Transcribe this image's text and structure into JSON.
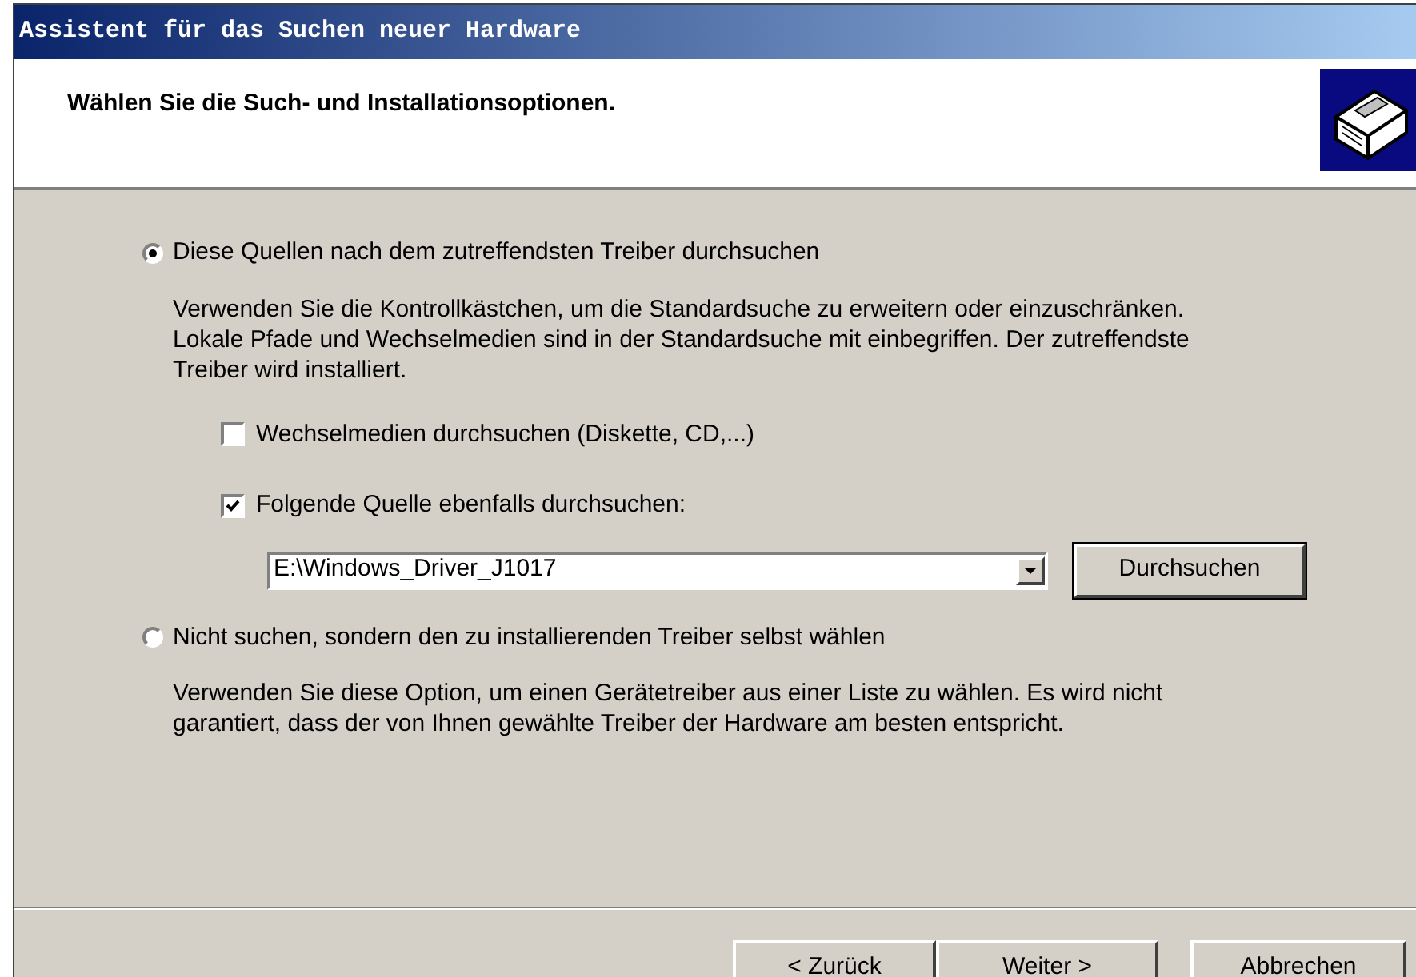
{
  "window": {
    "title": "Assistent für das Suchen neuer Hardware"
  },
  "header": {
    "heading": "Wählen Sie die Such- und Installationsoptionen."
  },
  "options": [
    {
      "label": "Diese Quellen nach dem zutreffendsten Treiber durchsuchen",
      "selected": true,
      "description": "Verwenden Sie die Kontrollkästchen, um die Standardsuche zu erweitern oder einzuschränken. Lokale Pfade und Wechselmedien sind in der Standardsuche mit einbegriffen. Der zutreffendste Treiber wird installiert.",
      "checkboxes": [
        {
          "label": "Wechselmedien durchsuchen (Diskette, CD,...)",
          "checked": false
        },
        {
          "label": "Folgende Quelle ebenfalls durchsuchen:",
          "checked": true
        }
      ],
      "path": {
        "value": "E:\\Windows_Driver_J1017",
        "browse_button": "Durchsuchen"
      }
    },
    {
      "label": "Nicht suchen, sondern den zu installierenden Treiber selbst wählen",
      "selected": false,
      "description": "Verwenden Sie diese Option, um einen Gerätetreiber aus einer Liste zu wählen. Es wird nicht garantiert, dass der von Ihnen gewählte Treiber der Hardware am besten entspricht."
    }
  ],
  "buttons": [
    {
      "label": "< Zurück"
    },
    {
      "label": "Weiter >"
    },
    {
      "label": "Abbrechen"
    }
  ]
}
